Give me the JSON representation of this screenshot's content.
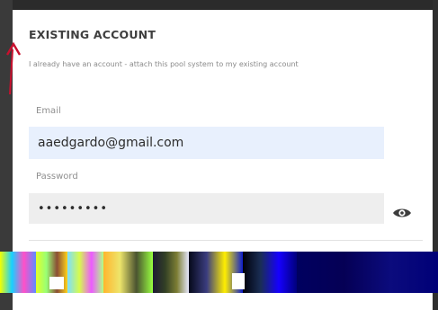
{
  "section": {
    "title": "EXISTING ACCOUNT",
    "description": "I already have an account - attach this pool system to my existing account"
  },
  "form": {
    "email": {
      "label": "Email",
      "value": "aaedgardo@gmail.com"
    },
    "password": {
      "label": "Password",
      "value": "•••••••••"
    },
    "toggle_icon": "eye-icon"
  },
  "annotation": {
    "arrow_color": "#c8102e"
  }
}
